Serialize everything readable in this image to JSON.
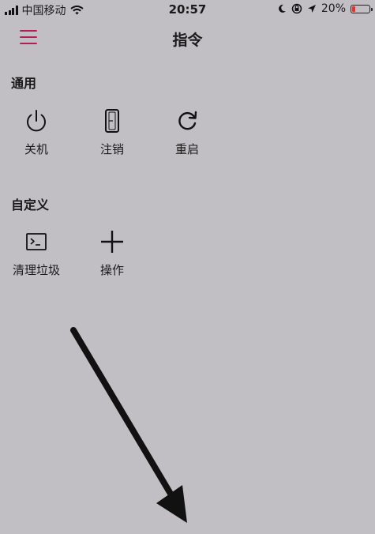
{
  "status_bar": {
    "carrier": "中国移动",
    "time": "20:57",
    "battery_percent": "20%",
    "battery_level": 0.2,
    "battery_color": "#e5342a"
  },
  "nav": {
    "title": "指令",
    "menu_icon": "hamburger-menu-icon",
    "accent_color": "#b01f55"
  },
  "sections": {
    "general": {
      "title": "通用",
      "items": [
        {
          "label": "关机",
          "icon": "power-icon"
        },
        {
          "label": "注销",
          "icon": "phone-logout-icon"
        },
        {
          "label": "重启",
          "icon": "restart-icon"
        }
      ]
    },
    "custom": {
      "title": "自定义",
      "items": [
        {
          "label": "清理垃圾",
          "icon": "terminal-icon"
        },
        {
          "label": "操作",
          "icon": "plus-icon"
        }
      ]
    }
  },
  "background_color": "#c1bfc4"
}
